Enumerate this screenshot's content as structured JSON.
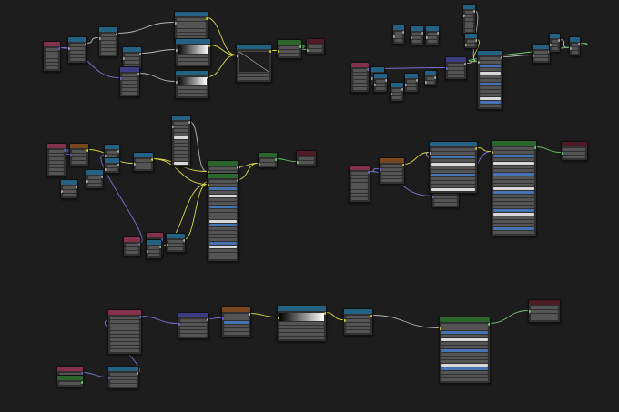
{
  "colors": {
    "input": "#83314a",
    "shader": "#2b652b",
    "texture": "#79461d",
    "converter": "#246283",
    "vector": "#3c3c83",
    "output": "#4d1a26",
    "socket_yellow": "#c7c729",
    "socket_grey": "#a1a1a1",
    "socket_purple": "#6363c7",
    "socket_green": "#63c763",
    "wire_yellow": "#d8d84a",
    "wire_grey": "#b5b5b5",
    "wire_purple": "#7a6fd0",
    "wire_green": "#6ec56e"
  },
  "nodes": [
    {
      "id": "n1",
      "kind": "input",
      "rows": 6,
      "sock_out": "socket_purple"
    },
    {
      "id": "n2",
      "kind": "converter",
      "rows": 5,
      "sock_in": "socket_grey",
      "sock_out": "socket_grey"
    },
    {
      "id": "n3",
      "kind": "converter",
      "rows": 6,
      "sock_in": "socket_grey",
      "sock_out": "socket_grey"
    },
    {
      "id": "n4",
      "kind": "converter",
      "rows": 4,
      "sock_in": "socket_grey",
      "sock_out": "socket_grey"
    },
    {
      "id": "n5",
      "kind": "converter",
      "rows": 6,
      "sock_in": "socket_grey",
      "sock_out": "socket_yellow"
    },
    {
      "id": "n6",
      "kind": "converter",
      "rows": 3,
      "ramp": true,
      "sock_in": "socket_grey",
      "sock_out": "socket_yellow"
    },
    {
      "id": "n7",
      "kind": "converter",
      "rows": 3,
      "ramp": true,
      "sock_in": "socket_grey",
      "sock_out": "socket_yellow"
    },
    {
      "id": "n8",
      "kind": "vector",
      "rows": 6,
      "sock_in": "socket_purple",
      "sock_out": "socket_grey"
    },
    {
      "id": "n9",
      "kind": "converter",
      "rows": 2,
      "graph": true,
      "sock_in": "socket_yellow",
      "sock_out": "socket_yellow"
    },
    {
      "id": "n10",
      "kind": "shader",
      "rows": 3,
      "sock_in": "socket_yellow",
      "sock_out": "socket_green"
    },
    {
      "id": "n11",
      "kind": "output",
      "rows": 2,
      "sock_in": "socket_green"
    },
    {
      "id": "n12",
      "kind": "converter",
      "rows": 6,
      "sock_in": "socket_grey",
      "sock_out": "socket_grey"
    },
    {
      "id": "n13",
      "kind": "converter",
      "rows": 3,
      "sock_in": "socket_grey",
      "sock_out": "socket_grey"
    },
    {
      "id": "n14",
      "kind": "converter",
      "rows": 3,
      "sock_in": "socket_grey",
      "sock_out": "socket_grey"
    },
    {
      "id": "n15",
      "kind": "converter",
      "rows": 3,
      "sock_in": "socket_grey",
      "sock_out": "socket_grey"
    },
    {
      "id": "n16",
      "kind": "converter",
      "rows": 2,
      "sock_in": "socket_grey",
      "sock_out": "socket_grey"
    },
    {
      "id": "n17",
      "kind": "input",
      "rows": 6,
      "sock_out": "socket_purple"
    },
    {
      "id": "n18",
      "kind": "converter",
      "rows": 3,
      "sock_in": "socket_grey",
      "sock_out": "socket_grey"
    },
    {
      "id": "n19",
      "kind": "converter",
      "rows": 3,
      "sock_in": "socket_grey",
      "sock_out": "socket_grey"
    },
    {
      "id": "n20",
      "kind": "converter",
      "rows": 3,
      "sock_in": "socket_grey",
      "sock_out": "socket_grey"
    },
    {
      "id": "n21",
      "kind": "converter",
      "rows": 3,
      "sock_in": "socket_grey",
      "sock_out": "socket_grey"
    },
    {
      "id": "n22",
      "kind": "converter",
      "rows": 2,
      "sock_in": "socket_grey",
      "sock_out": "socket_grey"
    },
    {
      "id": "n23",
      "kind": "vector",
      "rows": 4,
      "sock_in": "socket_purple",
      "sock_out": "socket_grey"
    },
    {
      "id": "n24",
      "kind": "converter",
      "rows": 14,
      "blue": true,
      "sock_in": "socket_grey",
      "sock_out": "socket_grey"
    },
    {
      "id": "n25",
      "kind": "converter",
      "rows": 3,
      "sock_in": "socket_grey",
      "sock_out": "socket_grey"
    },
    {
      "id": "n26",
      "kind": "converter",
      "rows": 3,
      "sock_in": "socket_grey",
      "sock_out": "socket_grey"
    },
    {
      "id": "n27",
      "kind": "converter",
      "rows": 3,
      "sock_in": "socket_grey",
      "sock_out": "socket_grey"
    },
    {
      "id": "n28",
      "kind": "converter",
      "rows": 12,
      "sock_in": "socket_grey",
      "sock_out": "socket_grey"
    },
    {
      "id": "n29",
      "kind": "input",
      "rows": 7,
      "sock_out": "socket_purple"
    },
    {
      "id": "n30",
      "kind": "texture",
      "rows": 4,
      "sock_in": "socket_purple",
      "sock_out": "socket_yellow"
    },
    {
      "id": "n31",
      "kind": "converter",
      "rows": 3,
      "sock_in": "socket_grey",
      "sock_out": "socket_grey"
    },
    {
      "id": "n32",
      "kind": "converter",
      "rows": 2,
      "sock_in": "socket_grey",
      "sock_out": "socket_grey"
    },
    {
      "id": "n33",
      "kind": "converter",
      "rows": 3,
      "sock_in": "socket_grey",
      "sock_out": "socket_yellow"
    },
    {
      "id": "n34",
      "kind": "shader",
      "rows": 4,
      "sock_in": "socket_yellow",
      "sock_out": "socket_yellow"
    },
    {
      "id": "n35",
      "kind": "converter",
      "rows": 3,
      "sock_in": "socket_grey",
      "sock_out": "socket_grey"
    },
    {
      "id": "n36",
      "kind": "converter",
      "rows": 3,
      "sock_in": "socket_grey",
      "sock_out": "socket_grey"
    },
    {
      "id": "n37",
      "kind": "shader",
      "rows": 2,
      "sock_in": "socket_yellow",
      "sock_out": "socket_green"
    },
    {
      "id": "n38",
      "kind": "output",
      "rows": 2,
      "sock_in": "socket_green"
    },
    {
      "id": "n39",
      "kind": "shader",
      "rows": 22,
      "blue": true,
      "sock_in": "socket_yellow",
      "sock_out": "socket_green"
    },
    {
      "id": "n40",
      "kind": "input",
      "rows": 3,
      "sock_out": "socket_purple"
    },
    {
      "id": "n41",
      "kind": "input",
      "rows": 4,
      "sock_out": "socket_purple"
    },
    {
      "id": "n42",
      "kind": "converter",
      "rows": 3,
      "sock_in": "socket_grey",
      "sock_out": "socket_grey"
    },
    {
      "id": "n43",
      "kind": "converter",
      "rows": 3,
      "sock_in": "socket_grey",
      "sock_out": "socket_grey"
    },
    {
      "id": "n44",
      "kind": "input",
      "rows": 8,
      "sock_out": "socket_purple"
    },
    {
      "id": "n45",
      "kind": "texture",
      "rows": 5,
      "sock_in": "socket_purple",
      "sock_out": "socket_yellow"
    },
    {
      "id": "n46",
      "kind": "vector",
      "rows": 4,
      "sock_in": "socket_purple",
      "sock_out": "socket_grey"
    },
    {
      "id": "n47",
      "kind": "converter",
      "rows": 12,
      "blue": true,
      "sock_in": "socket_grey",
      "sock_out": "socket_yellow"
    },
    {
      "id": "n48",
      "kind": "shader",
      "rows": 24,
      "blue": true,
      "sock_in": "socket_yellow",
      "sock_out": "socket_green"
    },
    {
      "id": "n49",
      "kind": "output",
      "rows": 3,
      "sock_in": "socket_green"
    },
    {
      "id": "n50",
      "kind": "input",
      "rows": 2,
      "sock_out": "socket_purple"
    },
    {
      "id": "n51",
      "kind": "shader",
      "rows": 1,
      "sock_out": "socket_green"
    },
    {
      "id": "n52",
      "kind": "converter",
      "rows": 4,
      "sock_in": "socket_purple",
      "sock_out": "socket_grey"
    },
    {
      "id": "n53",
      "kind": "input",
      "rows": 10,
      "sock_out": "socket_purple"
    },
    {
      "id": "n54",
      "kind": "vector",
      "rows": 5,
      "sock_in": "socket_purple",
      "sock_out": "socket_yellow"
    },
    {
      "id": "n55",
      "kind": "texture",
      "rows": 6,
      "blue": true,
      "sock_in": "socket_purple",
      "sock_out": "socket_yellow"
    },
    {
      "id": "n56",
      "kind": "converter",
      "rows": 5,
      "ramp": true,
      "sock_in": "socket_yellow",
      "sock_out": "socket_yellow"
    },
    {
      "id": "n57",
      "kind": "converter",
      "rows": 5,
      "sock_in": "socket_yellow",
      "sock_out": "socket_yellow"
    },
    {
      "id": "n58",
      "kind": "shader",
      "rows": 16,
      "blue": true,
      "sock_in": "socket_yellow",
      "sock_out": "socket_green"
    },
    {
      "id": "n59",
      "kind": "output",
      "rows": 4,
      "sock_in": "socket_green"
    }
  ],
  "links": [
    {
      "from": "n1",
      "to": "n2",
      "color": "wire_purple"
    },
    {
      "from": "n1",
      "to": "n8",
      "color": "wire_purple"
    },
    {
      "from": "n2",
      "to": "n3",
      "color": "wire_grey"
    },
    {
      "from": "n3",
      "to": "n5",
      "color": "wire_grey"
    },
    {
      "from": "n4",
      "to": "n6",
      "color": "wire_grey"
    },
    {
      "from": "n5",
      "to": "n9",
      "color": "wire_yellow"
    },
    {
      "from": "n6",
      "to": "n9",
      "color": "wire_yellow"
    },
    {
      "from": "n7",
      "to": "n9",
      "color": "wire_yellow"
    },
    {
      "from": "n8",
      "to": "n7",
      "color": "wire_grey"
    },
    {
      "from": "n9",
      "to": "n10",
      "color": "wire_yellow"
    },
    {
      "from": "n10",
      "to": "n11",
      "color": "wire_green"
    },
    {
      "from": "n12",
      "to": "n24",
      "color": "wire_grey"
    },
    {
      "from": "n16",
      "to": "n24",
      "color": "wire_yellow"
    },
    {
      "from": "n17",
      "to": "n18",
      "color": "wire_purple"
    },
    {
      "from": "n17",
      "to": "n23",
      "color": "wire_purple"
    },
    {
      "from": "n23",
      "to": "n24",
      "color": "wire_grey"
    },
    {
      "from": "n24",
      "to": "n25",
      "color": "wire_grey"
    },
    {
      "from": "n26",
      "to": "n27",
      "color": "wire_grey"
    },
    {
      "from": "n27",
      "to": "n24",
      "color": "wire_green"
    },
    {
      "from": "n29",
      "to": "n30",
      "color": "wire_purple"
    },
    {
      "from": "n30",
      "to": "n33",
      "color": "wire_yellow"
    },
    {
      "from": "n28",
      "to": "n34",
      "color": "wire_grey"
    },
    {
      "from": "n33",
      "to": "n34",
      "color": "wire_yellow"
    },
    {
      "from": "n33",
      "to": "n39",
      "color": "wire_yellow"
    },
    {
      "from": "n34",
      "to": "n39",
      "color": "wire_yellow"
    },
    {
      "from": "n34",
      "to": "n37",
      "color": "wire_yellow"
    },
    {
      "from": "n37",
      "to": "n38",
      "color": "wire_green"
    },
    {
      "from": "n39",
      "to": "n37",
      "color": "wire_yellow"
    },
    {
      "from": "n42",
      "to": "n39",
      "color": "wire_yellow"
    },
    {
      "from": "n43",
      "to": "n39",
      "color": "wire_yellow"
    },
    {
      "from": "n40",
      "to": "n31",
      "color": "wire_purple"
    },
    {
      "from": "n44",
      "to": "n45",
      "color": "wire_purple"
    },
    {
      "from": "n44",
      "to": "n46",
      "color": "wire_purple"
    },
    {
      "from": "n45",
      "to": "n47",
      "color": "wire_yellow"
    },
    {
      "from": "n46",
      "to": "n47",
      "color": "wire_grey"
    },
    {
      "from": "n46",
      "to": "n48",
      "color": "wire_purple"
    },
    {
      "from": "n47",
      "to": "n48",
      "color": "wire_yellow"
    },
    {
      "from": "n48",
      "to": "n49",
      "color": "wire_green"
    },
    {
      "from": "n50",
      "to": "n52",
      "color": "wire_purple"
    },
    {
      "from": "n52",
      "to": "n53",
      "color": "wire_purple"
    },
    {
      "from": "n53",
      "to": "n54",
      "color": "wire_purple"
    },
    {
      "from": "n54",
      "to": "n55",
      "color": "wire_purple"
    },
    {
      "from": "n55",
      "to": "n56",
      "color": "wire_yellow"
    },
    {
      "from": "n56",
      "to": "n57",
      "color": "wire_yellow"
    },
    {
      "from": "n57",
      "to": "n58",
      "color": "wire_grey"
    },
    {
      "from": "n58",
      "to": "n59",
      "color": "wire_green"
    }
  ]
}
